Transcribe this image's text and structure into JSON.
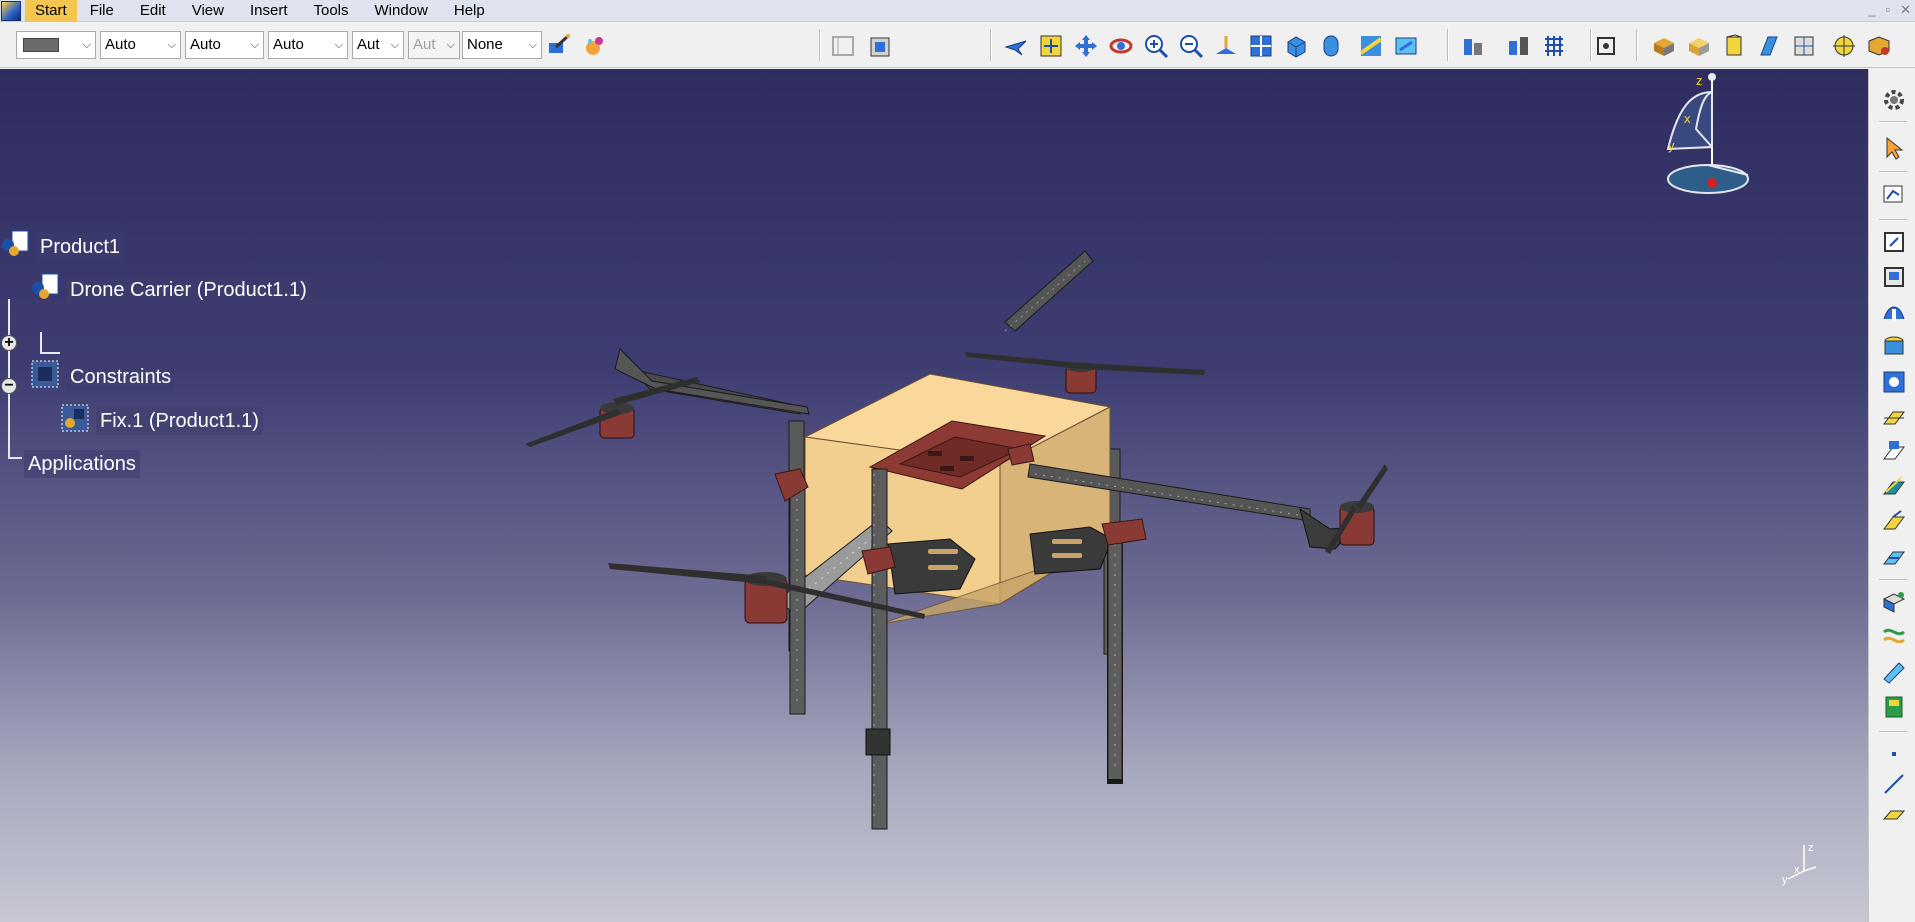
{
  "menubar": {
    "items": [
      {
        "label": "Start",
        "mnemonic": "S"
      },
      {
        "label": "File",
        "mnemonic": "F"
      },
      {
        "label": "Edit",
        "mnemonic": "E"
      },
      {
        "label": "View",
        "mnemonic": "V"
      },
      {
        "label": "Insert",
        "mnemonic": "I"
      },
      {
        "label": "Tools",
        "mnemonic": "T"
      },
      {
        "label": "Window",
        "mnemonic": "W"
      },
      {
        "label": "Help",
        "mnemonic": "H"
      }
    ],
    "window_controls": [
      "_",
      "▫",
      "✕"
    ]
  },
  "toolbar": {
    "combos": {
      "line_thickness": "Auto",
      "line_type": "Auto",
      "layer": "Auto",
      "transparency": "Aut",
      "render": "Aut",
      "filter": "None"
    }
  },
  "tree": {
    "root": "Product1",
    "child1": "Drone Carrier (Product1.1)",
    "child2": "Constraints",
    "child2_sub": "Fix.1 (Product1.1)",
    "applications": "Applications"
  },
  "compass": {
    "x": "x",
    "y": "y",
    "z": "z"
  },
  "colors": {
    "viewport_top": "#2f2d60",
    "viewport_bottom": "#c7c8d3",
    "frame": "#3c3c3c",
    "motor": "#8a3a34",
    "plate": "#8c3a33",
    "cargo_box": "#f2cf8f",
    "menu_highlight": "#f5c64f"
  }
}
